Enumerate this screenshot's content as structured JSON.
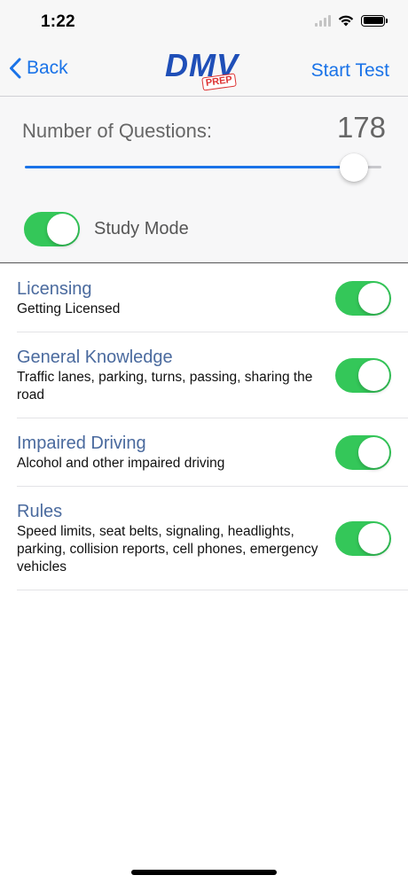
{
  "status_bar": {
    "time": "1:22"
  },
  "nav": {
    "back_label": "Back",
    "logo_text": "DMV",
    "logo_badge": "PREP",
    "start_label": "Start Test"
  },
  "settings": {
    "questions_label": "Number of Questions:",
    "questions_count": "178",
    "slider_fraction": 0.96,
    "study_mode_label": "Study Mode",
    "study_mode_on": true
  },
  "categories": [
    {
      "title": "Licensing",
      "description": "Getting Licensed",
      "enabled": true
    },
    {
      "title": "General Knowledge",
      "description": "Traffic lanes, parking, turns, passing, sharing the road",
      "enabled": true
    },
    {
      "title": "Impaired Driving",
      "description": "Alcohol and other impaired driving",
      "enabled": true
    },
    {
      "title": "Rules",
      "description": "Speed limits, seat belts, signaling, headlights, parking, collision reports, cell phones, emergency vehicles",
      "enabled": true
    }
  ],
  "colors": {
    "accent": "#1a73e8",
    "toggle_on": "#34c759",
    "category_title": "#4a6a9e"
  }
}
